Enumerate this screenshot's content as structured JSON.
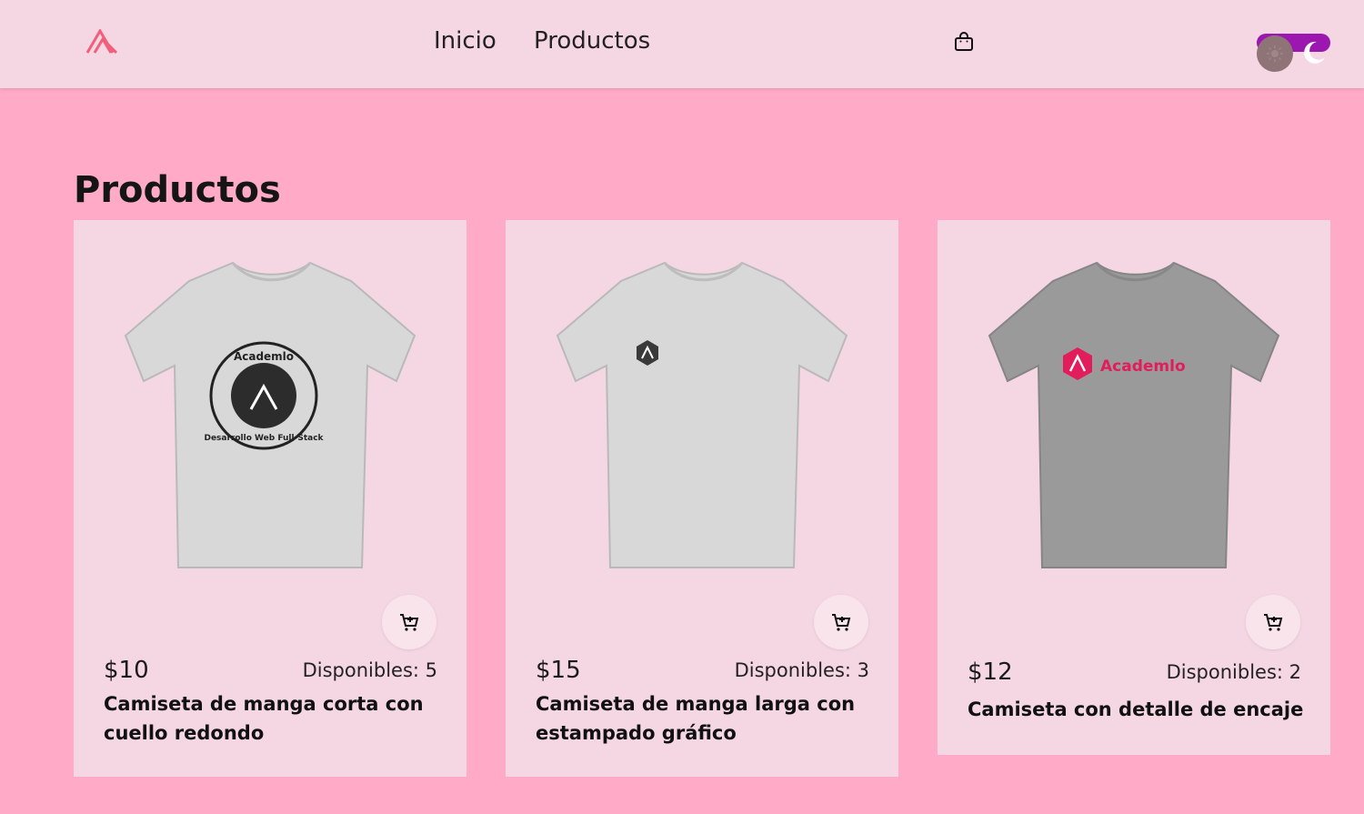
{
  "header": {
    "logo_icon": "academlo-logo-icon",
    "nav": [
      {
        "label": "Inicio"
      },
      {
        "label": "Productos"
      }
    ],
    "cart_icon": "shopping-bag-icon",
    "theme_toggle": {
      "sun_icon": "sun-icon",
      "moon_icon": "moon-icon",
      "track_color": "#9b17b0"
    }
  },
  "main": {
    "title": "Productos",
    "products": [
      {
        "price": "$10",
        "stock": "Disponibles: 5",
        "name": "Camiseta de manga corta con cuello redondo",
        "shirt_color": "#d8d8d8",
        "print": "Academlo",
        "print_ring": "Desarrollo Web Full-Stack"
      },
      {
        "price": "$15",
        "stock": "Disponibles: 3",
        "name": "Camiseta de manga larga con estampado gráfico",
        "shirt_color": "#d8d8d8"
      },
      {
        "price": "$12",
        "stock": "Disponibles: 2",
        "name": "Camiseta con detalle de encaje",
        "shirt_color": "#9a9a9a",
        "print": "Academlo",
        "print_color": "#e11d5b"
      }
    ]
  },
  "colors": {
    "background": "#ffaac6",
    "header": "#f5d6e3",
    "card": "#f5d6e3",
    "brand": "#f0607a"
  }
}
